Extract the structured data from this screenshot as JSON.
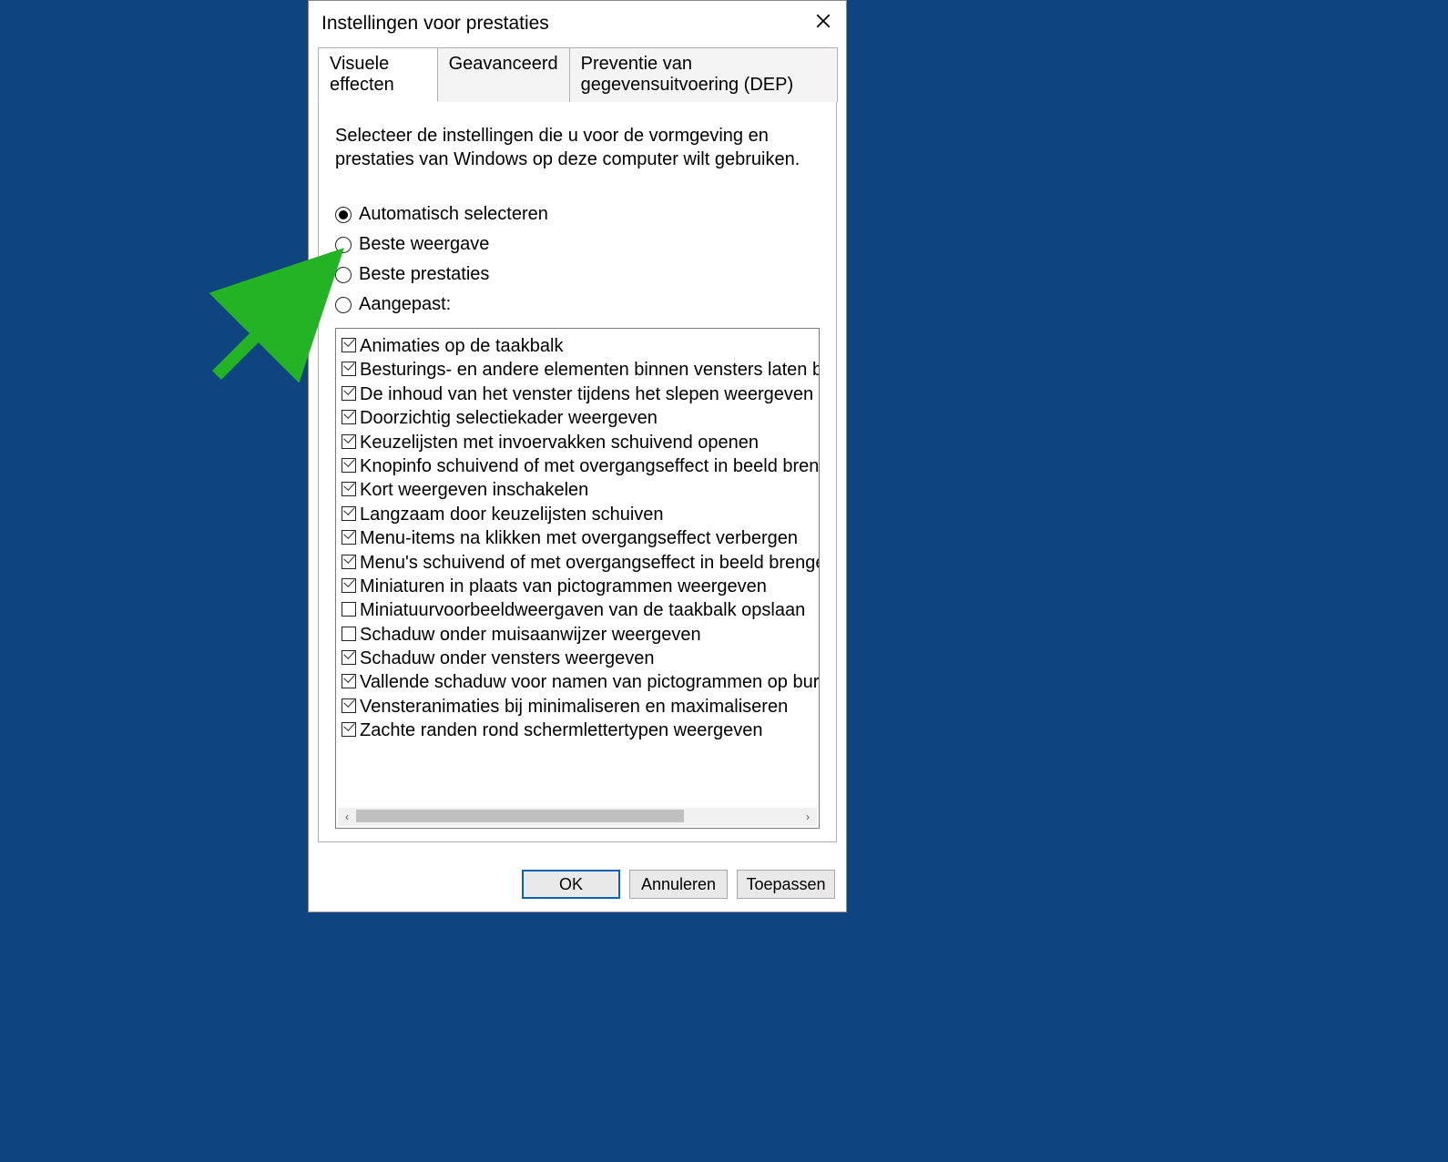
{
  "dialog": {
    "title": "Instellingen voor prestaties",
    "tabs": [
      "Visuele effecten",
      "Geavanceerd",
      "Preventie van gegevensuitvoering (DEP)"
    ],
    "active_tab": 0,
    "intro": "Selecteer de instellingen die u voor de vormgeving en prestaties van Windows op deze computer wilt gebruiken.",
    "radios": [
      {
        "label": "Automatisch selecteren",
        "selected": true
      },
      {
        "label": "Beste weergave",
        "selected": false
      },
      {
        "label": "Beste prestaties",
        "selected": false
      },
      {
        "label": "Aangepast:",
        "selected": false
      }
    ],
    "options": [
      {
        "label": "Animaties op de taakbalk",
        "checked": true
      },
      {
        "label": "Besturings- en andere elementen binnen vensters laten bewe",
        "checked": true
      },
      {
        "label": "De inhoud van het venster tijdens het slepen weergeven",
        "checked": true
      },
      {
        "label": "Doorzichtig selectiekader weergeven",
        "checked": true
      },
      {
        "label": "Keuzelijsten met invoervakken schuivend openen",
        "checked": true
      },
      {
        "label": "Knopinfo schuivend of met overgangseffect in beeld brengen",
        "checked": true
      },
      {
        "label": "Kort weergeven inschakelen",
        "checked": true
      },
      {
        "label": "Langzaam door keuzelijsten schuiven",
        "checked": true
      },
      {
        "label": "Menu-items na klikken met overgangseffect verbergen",
        "checked": true
      },
      {
        "label": "Menu's schuivend of met overgangseffect in beeld brengen",
        "checked": true
      },
      {
        "label": "Miniaturen in plaats van pictogrammen weergeven",
        "checked": true
      },
      {
        "label": "Miniatuurvoorbeeldweergaven van de taakbalk opslaan",
        "checked": false
      },
      {
        "label": "Schaduw onder muisaanwijzer weergeven",
        "checked": false
      },
      {
        "label": "Schaduw onder vensters weergeven",
        "checked": true
      },
      {
        "label": "Vallende schaduw voor namen van pictogrammen op bureau",
        "checked": true
      },
      {
        "label": "Vensteranimaties bij minimaliseren en maximaliseren",
        "checked": true
      },
      {
        "label": "Zachte randen rond schermlettertypen weergeven",
        "checked": true
      }
    ],
    "buttons": {
      "ok": "OK",
      "cancel": "Annuleren",
      "apply": "Toepassen"
    },
    "scroll_arrows": {
      "left": "‹",
      "right": "›"
    }
  },
  "annotation_arrow": {
    "color": "#24b324"
  }
}
